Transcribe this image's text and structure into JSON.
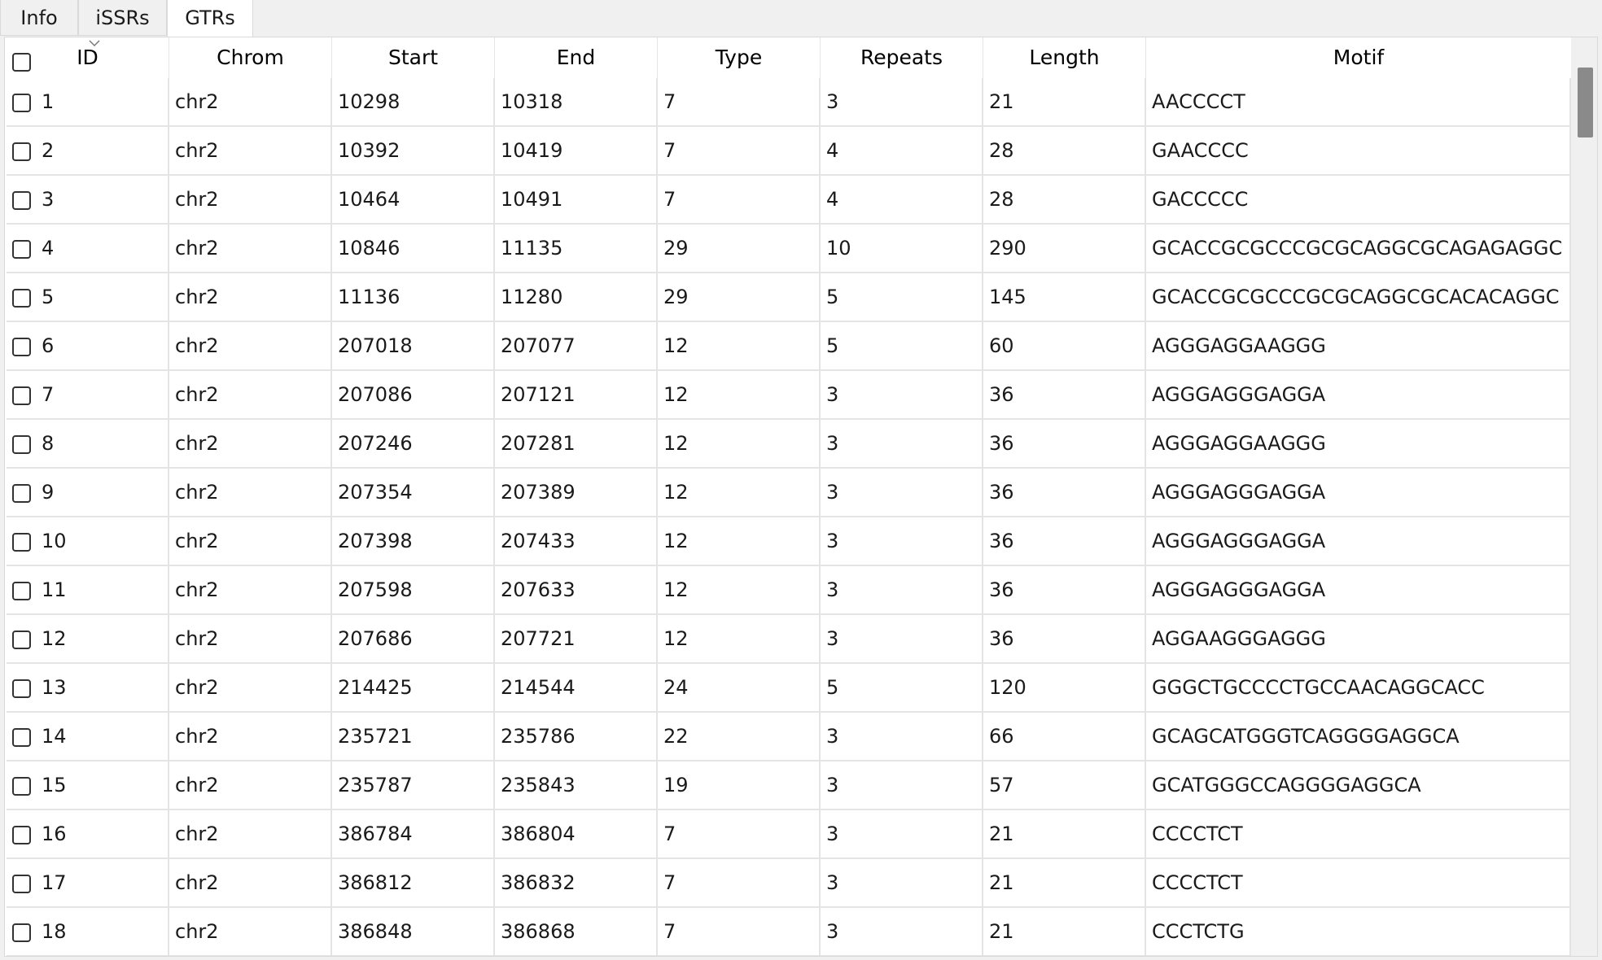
{
  "tabs": [
    {
      "label": "Info",
      "active": false
    },
    {
      "label": "iSSRs",
      "active": false
    },
    {
      "label": "GTRs",
      "active": true
    }
  ],
  "table": {
    "columns": [
      "ID",
      "Chrom",
      "Start",
      "End",
      "Type",
      "Repeats",
      "Length",
      "Motif"
    ],
    "sort_column": "ID",
    "rows": [
      {
        "id": "1",
        "chrom": "chr2",
        "start": "10298",
        "end": "10318",
        "type": "7",
        "repeats": "3",
        "length": "21",
        "motif": "AACCCCT"
      },
      {
        "id": "2",
        "chrom": "chr2",
        "start": "10392",
        "end": "10419",
        "type": "7",
        "repeats": "4",
        "length": "28",
        "motif": "GAACCCC"
      },
      {
        "id": "3",
        "chrom": "chr2",
        "start": "10464",
        "end": "10491",
        "type": "7",
        "repeats": "4",
        "length": "28",
        "motif": "GACCCCC"
      },
      {
        "id": "4",
        "chrom": "chr2",
        "start": "10846",
        "end": "11135",
        "type": "29",
        "repeats": "10",
        "length": "290",
        "motif": "GCACCGCGCCCGCGCAGGCGCAGAGAGGC"
      },
      {
        "id": "5",
        "chrom": "chr2",
        "start": "11136",
        "end": "11280",
        "type": "29",
        "repeats": "5",
        "length": "145",
        "motif": "GCACCGCGCCCGCGCAGGCGCACACAGGC"
      },
      {
        "id": "6",
        "chrom": "chr2",
        "start": "207018",
        "end": "207077",
        "type": "12",
        "repeats": "5",
        "length": "60",
        "motif": "AGGGAGGAAGGG"
      },
      {
        "id": "7",
        "chrom": "chr2",
        "start": "207086",
        "end": "207121",
        "type": "12",
        "repeats": "3",
        "length": "36",
        "motif": "AGGGAGGGAGGA"
      },
      {
        "id": "8",
        "chrom": "chr2",
        "start": "207246",
        "end": "207281",
        "type": "12",
        "repeats": "3",
        "length": "36",
        "motif": "AGGGAGGAAGGG"
      },
      {
        "id": "9",
        "chrom": "chr2",
        "start": "207354",
        "end": "207389",
        "type": "12",
        "repeats": "3",
        "length": "36",
        "motif": "AGGGAGGGAGGA"
      },
      {
        "id": "10",
        "chrom": "chr2",
        "start": "207398",
        "end": "207433",
        "type": "12",
        "repeats": "3",
        "length": "36",
        "motif": "AGGGAGGGAGGA"
      },
      {
        "id": "11",
        "chrom": "chr2",
        "start": "207598",
        "end": "207633",
        "type": "12",
        "repeats": "3",
        "length": "36",
        "motif": "AGGGAGGGAGGA"
      },
      {
        "id": "12",
        "chrom": "chr2",
        "start": "207686",
        "end": "207721",
        "type": "12",
        "repeats": "3",
        "length": "36",
        "motif": "AGGAAGGGAGGG"
      },
      {
        "id": "13",
        "chrom": "chr2",
        "start": "214425",
        "end": "214544",
        "type": "24",
        "repeats": "5",
        "length": "120",
        "motif": "GGGCTGCCCCTGCCAACAGGCACC"
      },
      {
        "id": "14",
        "chrom": "chr2",
        "start": "235721",
        "end": "235786",
        "type": "22",
        "repeats": "3",
        "length": "66",
        "motif": "GCAGCATGGGTCAGGGGAGGCA"
      },
      {
        "id": "15",
        "chrom": "chr2",
        "start": "235787",
        "end": "235843",
        "type": "19",
        "repeats": "3",
        "length": "57",
        "motif": "GCATGGGCCAGGGGAGGCA"
      },
      {
        "id": "16",
        "chrom": "chr2",
        "start": "386784",
        "end": "386804",
        "type": "7",
        "repeats": "3",
        "length": "21",
        "motif": "CCCCTCT"
      },
      {
        "id": "17",
        "chrom": "chr2",
        "start": "386812",
        "end": "386832",
        "type": "7",
        "repeats": "3",
        "length": "21",
        "motif": "CCCCTCT"
      },
      {
        "id": "18",
        "chrom": "chr2",
        "start": "386848",
        "end": "386868",
        "type": "7",
        "repeats": "3",
        "length": "21",
        "motif": "CCCTCTG"
      }
    ]
  },
  "colors": {
    "window_bg": "#f0f0f0",
    "table_bg": "#ffffff",
    "grid_line": "#e4e4e4",
    "scroll_thumb": "#8a8a8a"
  }
}
